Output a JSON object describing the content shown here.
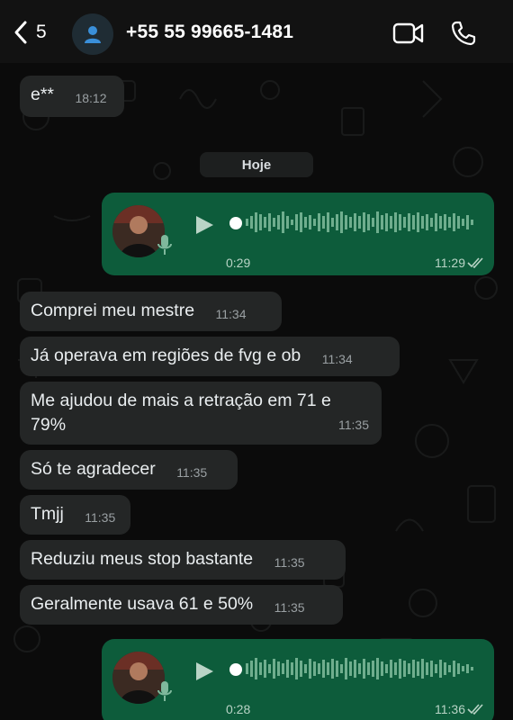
{
  "header": {
    "back_count": "5",
    "contact": "+55 55 99665-1481"
  },
  "chat": {
    "date_chip": "Hoje",
    "first_message": {
      "text": "e**",
      "time": "18:12"
    },
    "voice_messages": [
      {
        "duration": "0:29",
        "time": "11:29"
      },
      {
        "duration": "0:28",
        "time": "11:36"
      }
    ],
    "messages": [
      {
        "text": "Comprei meu mestre",
        "time": "11:34"
      },
      {
        "text": "Já operava em regiões de fvg e ob",
        "time": "11:34"
      },
      {
        "text": "Me ajudou de mais a retração em 71 e 79%",
        "time": "11:35"
      },
      {
        "text": "Só te agradecer",
        "time": "11:35"
      },
      {
        "text": "Tmjj",
        "time": "11:35"
      },
      {
        "text": "Reduziu meus stop bastante",
        "time": "11:35"
      },
      {
        "text": "Geralmente usava 61 e 50%",
        "time": "11:35"
      }
    ]
  },
  "colors": {
    "header_bg": "#121212",
    "chat_bg": "#0b0b0b",
    "incoming_bubble": "#242626",
    "outgoing_bubble": "#0d5c3b",
    "text": "#e9edef",
    "timestamp": "#9aa0a3"
  },
  "icons": [
    "chevron-left-icon",
    "person-icon",
    "video-camera-icon",
    "phone-icon",
    "play-icon",
    "mic-icon",
    "double-check-icon"
  ]
}
